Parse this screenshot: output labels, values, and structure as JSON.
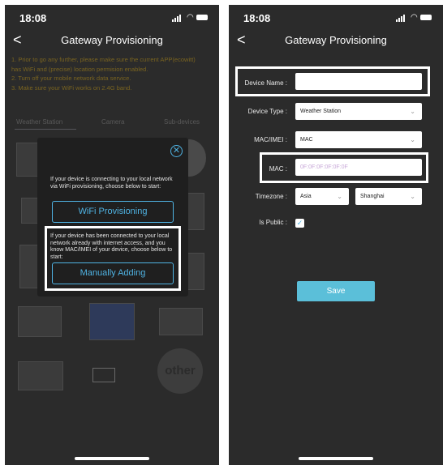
{
  "status_bar": {
    "time": "18:08"
  },
  "left": {
    "nav_title": "Gateway Provisioning",
    "back_glyph": "<",
    "notice_lines": [
      "1. Prior to go any further, please make sure the current APP(ecowitt)",
      "has WiFi and (precise) location permision enabled.",
      "2. Turn off your mobile network data service.",
      "3. Make sure your WiFi works on 2.4G band."
    ],
    "tabs": [
      "Weather Station",
      "Camera",
      "Sub-devices"
    ],
    "other_label": "other",
    "modal": {
      "close_glyph": "✕",
      "text_wifi": "If your device is connecting to your local network via WiFi provisioning, choose below to start:",
      "button_wifi": "WiFi Provisioning",
      "text_manual": "If your device has been connected to your local network already with internet access, and you know MAC/IMEI of your device, choose below to start:",
      "button_manual": "Manually Adding"
    }
  },
  "right": {
    "nav_title": "Gateway Provisioning",
    "back_glyph": "<",
    "labels": {
      "device_name": "Device Name :",
      "device_type": "Device Type :",
      "mac_imei": "MAC/IMEI :",
      "mac": "MAC :",
      "timezone": "Timezone :",
      "is_public": "Is Public :"
    },
    "device_name_value": "",
    "device_type_value": "Weather Station",
    "mac_imei_value": "MAC",
    "mac_placeholder": "0F:0F:0F:0F:0F:0F",
    "timezone_region": "Asia",
    "timezone_city": "Shanghai",
    "is_public_checked": true,
    "save_label": "Save",
    "chevron_glyph": "⌄",
    "check_glyph": "✓"
  },
  "colors": {
    "accent": "#4fb3e3",
    "save_button": "#5bbfd9",
    "phone_bg": "#2b2b2b",
    "highlight": "#ffffff"
  }
}
